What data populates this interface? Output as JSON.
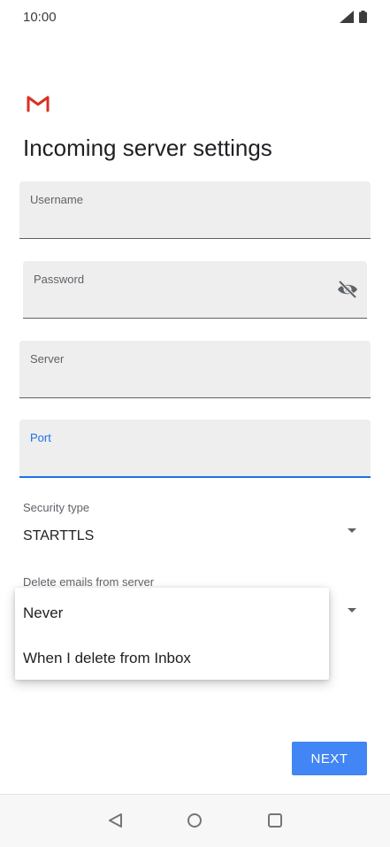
{
  "status_bar": {
    "time": "10:00"
  },
  "header": {
    "title": "Incoming server settings"
  },
  "fields": {
    "username": {
      "label": "Username",
      "value": ""
    },
    "password": {
      "label": "Password",
      "value": ""
    },
    "server": {
      "label": "Server",
      "value": ""
    },
    "port": {
      "label": "Port",
      "value": ""
    }
  },
  "security_type": {
    "label": "Security type",
    "value": "STARTTLS"
  },
  "delete_emails": {
    "label": "Delete emails from server"
  },
  "dropdown_menu": {
    "options": [
      "Never",
      "When I delete from Inbox"
    ]
  },
  "actions": {
    "next_label": "NEXT"
  },
  "colors": {
    "accent": "#1a73e8",
    "button": "#4285f4",
    "gmail_red": "#d93025"
  },
  "icons": [
    "signal-icon",
    "battery-icon",
    "gmail-logo-icon",
    "eye-off-icon",
    "back-icon",
    "home-icon",
    "recents-icon"
  ]
}
